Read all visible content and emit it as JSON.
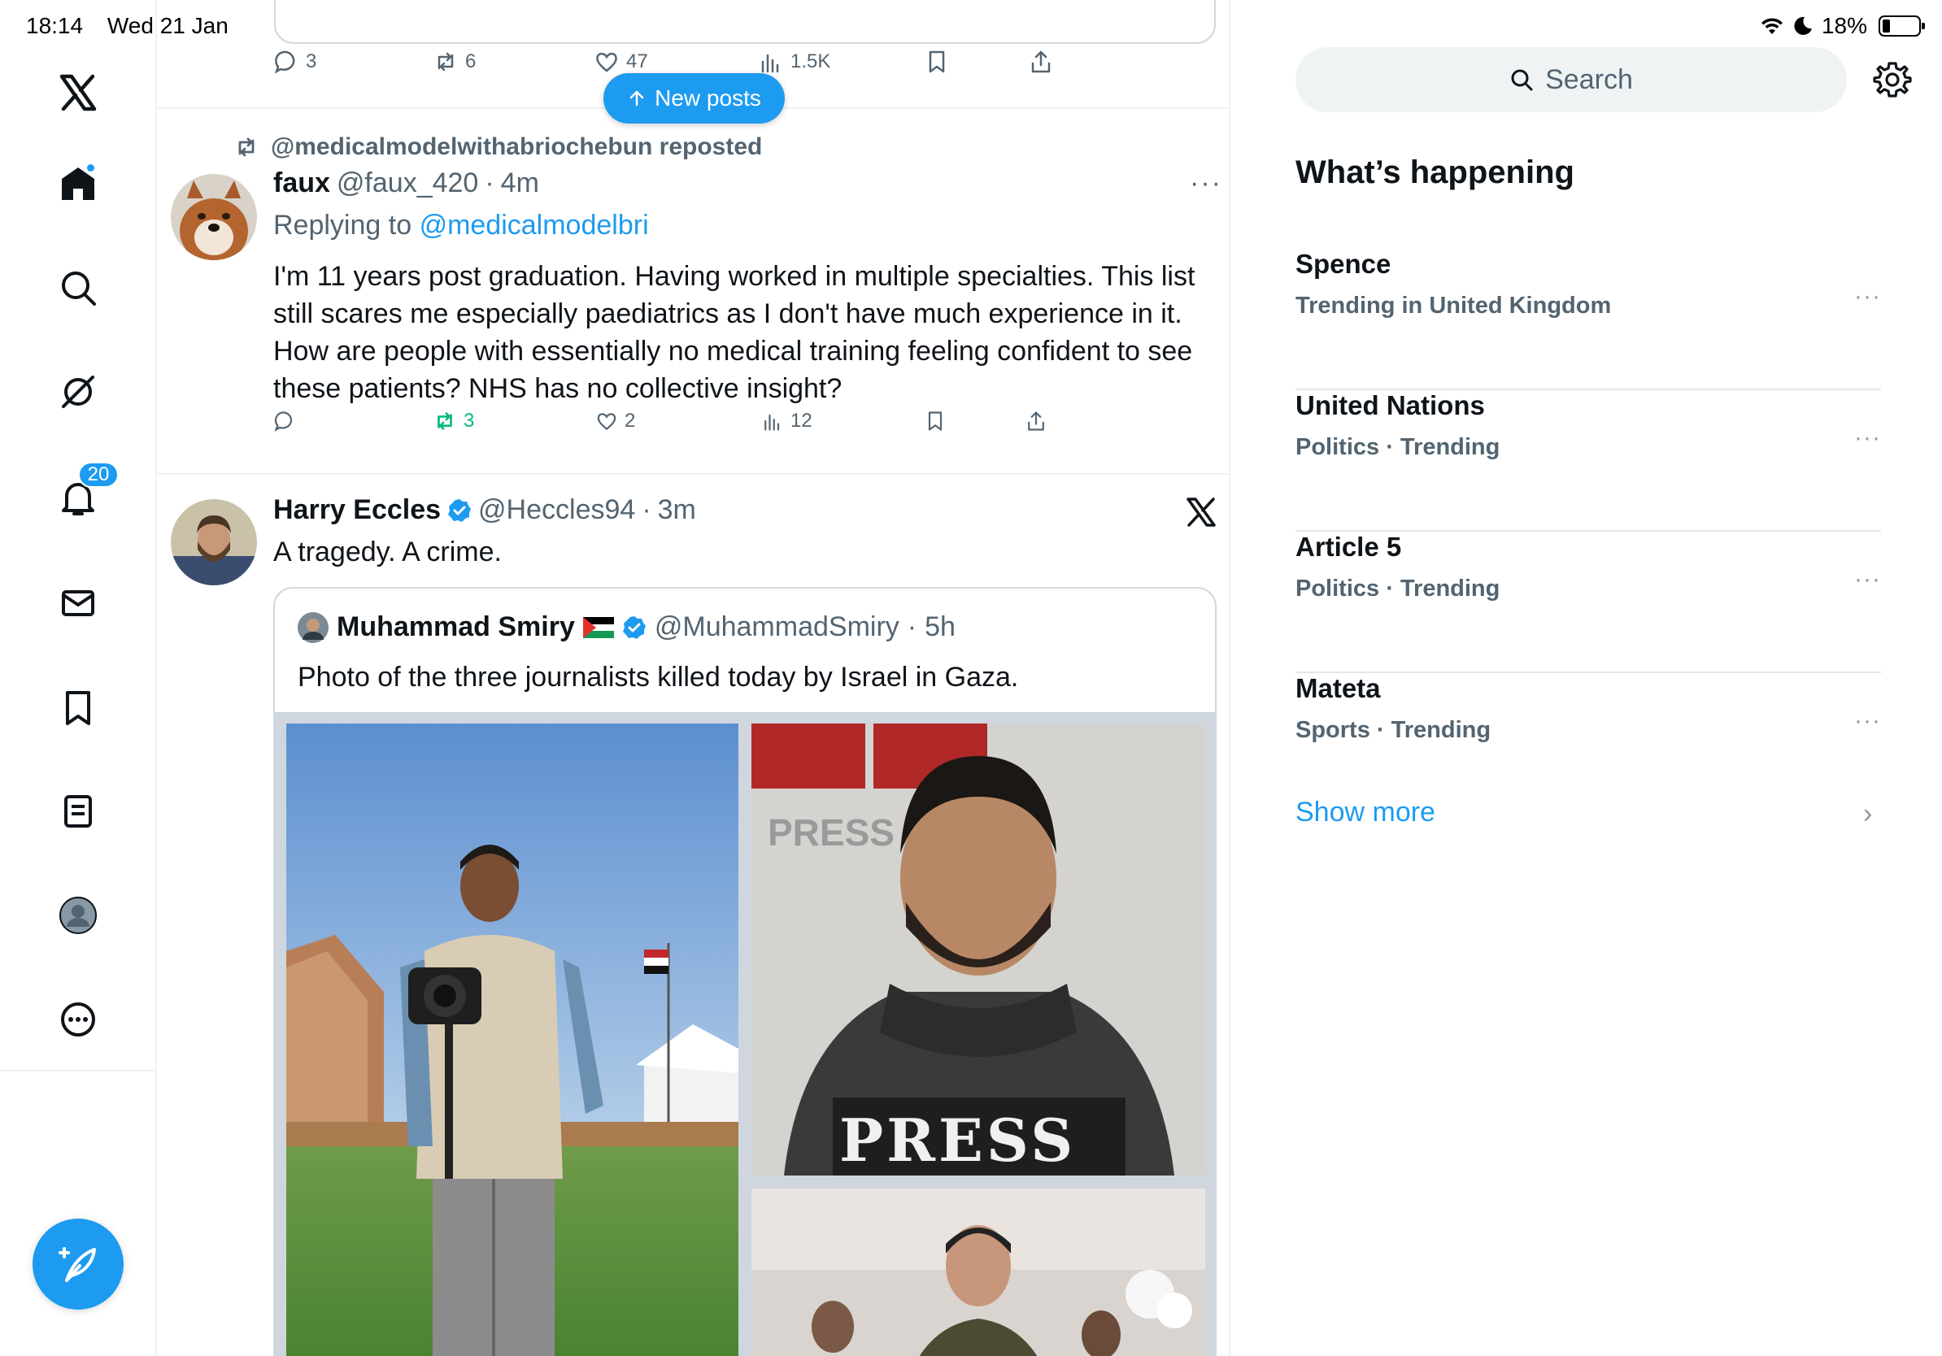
{
  "status_bar": {
    "time": "18:14",
    "date": "Wed 21 Jan",
    "battery": "18%"
  },
  "nav": {
    "notifications_count": "20"
  },
  "top_post": {
    "replies": "3",
    "reposts": "6",
    "likes": "47",
    "views": "1.5K"
  },
  "new_posts_label": "New posts",
  "post1": {
    "repost_by": "@medicalmodelwithabriochebun reposted",
    "name": "faux",
    "handle": "@faux_420",
    "time": "4m",
    "replying_prefix": "Replying to",
    "replying_to": "@medicalmodelbri",
    "text": "I'm 11 years post graduation. Having worked in multiple specialties. This list still scares me especially paediatrics as I don't have much experience in it. How are people with essentially no medical training feeling confident to see these patients? NHS has no collective insight?",
    "reposts": "3",
    "likes": "2",
    "views": "12"
  },
  "post2": {
    "name": "Harry Eccles",
    "handle": "@Heccles94",
    "time": "3m",
    "text": "A tragedy. A crime.",
    "quote": {
      "name": "Muhammad Smiry",
      "handle": "@MuhammadSmiry",
      "time": "5h",
      "text": "Photo of the three journalists killed today by Israel in Gaza.",
      "press_text": "PRESS"
    }
  },
  "sidebar": {
    "search_placeholder": "Search",
    "section_title": "What’s happening",
    "trends": [
      {
        "name": "Spence",
        "context": "Trending in United Kingdom"
      },
      {
        "name": "United Nations",
        "context": "Politics · Trending"
      },
      {
        "name": "Article 5",
        "context": "Politics · Trending"
      },
      {
        "name": "Mateta",
        "context": "Sports · Trending"
      }
    ],
    "show_more": "Show more"
  },
  "colors": {
    "accent": "#1d9bf0",
    "repost_green": "#00ba7c",
    "secondary_text": "#536471"
  }
}
